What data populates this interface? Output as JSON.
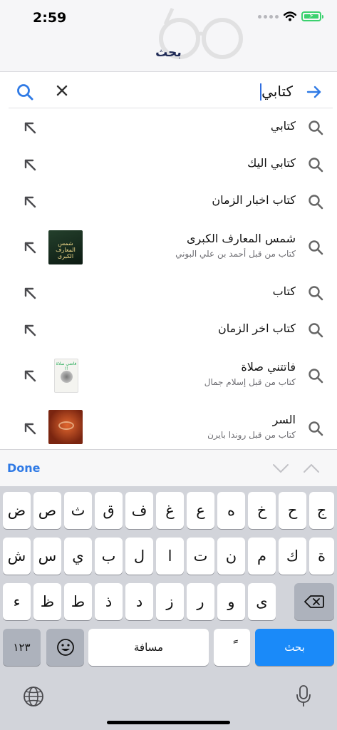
{
  "status": {
    "time": "2:59"
  },
  "nav": {
    "title": "بحث"
  },
  "search": {
    "query": "كتابي"
  },
  "suggestions": [
    {
      "title": "كتابي",
      "subtitle": ""
    },
    {
      "title": "كتابي اليك",
      "subtitle": ""
    },
    {
      "title": "كتاب اخبار الزمان",
      "subtitle": ""
    },
    {
      "title": "شمس المعارف الكبرى",
      "subtitle": "كتاب من قبل أحمد بن علي البوني",
      "cover_text": "شمس المعارف الكبرى"
    },
    {
      "title": "كتاب",
      "subtitle": ""
    },
    {
      "title": "كتاب اخر الزمان",
      "subtitle": ""
    },
    {
      "title": "فاتتني صلاة",
      "subtitle": "كتاب من قبل إسلام جمال",
      "cover_text": "فاتتني صلاة !!"
    },
    {
      "title": "السر",
      "subtitle": "كتاب من قبل روندا بايرن"
    }
  ],
  "accessory": {
    "done_label": "Done"
  },
  "keyboard": {
    "row1": [
      "ض",
      "ص",
      "ث",
      "ق",
      "ف",
      "غ",
      "ع",
      "ه",
      "خ",
      "ح",
      "ج"
    ],
    "row2": [
      "ش",
      "س",
      "ي",
      "ب",
      "ل",
      "ا",
      "ت",
      "ن",
      "م",
      "ك",
      "ة"
    ],
    "row3": [
      "ء",
      "ظ",
      "ط",
      "ذ",
      "د",
      "ز",
      "ر",
      "و",
      "ى"
    ],
    "numbers_label": "١٢٣",
    "space_label": "مسافة",
    "tanween_label": "ً",
    "search_label": "بحث"
  },
  "colors": {
    "accent": "#2f7ae5",
    "nav_title": "#1f2a56",
    "key_blue": "#1a8af9",
    "battery": "#3bd16f"
  }
}
